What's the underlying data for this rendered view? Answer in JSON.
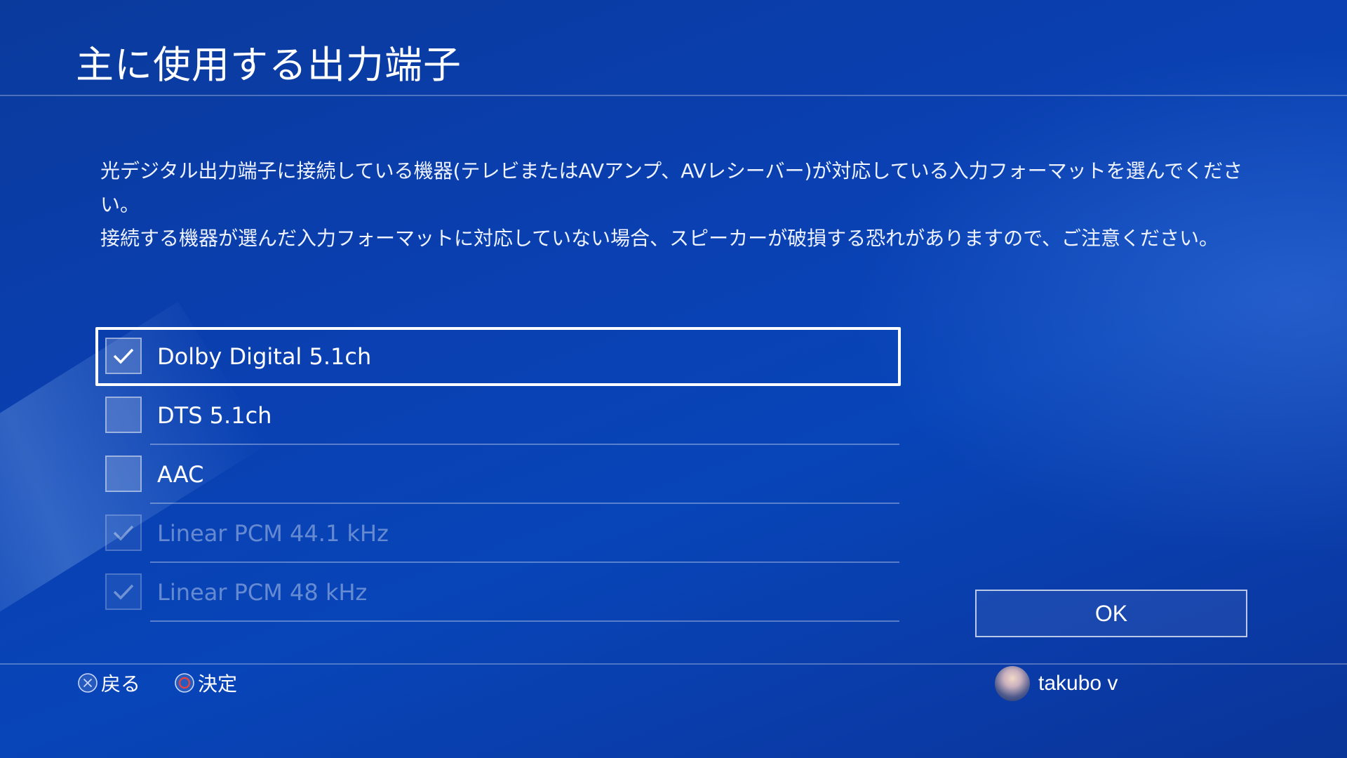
{
  "screen": {
    "title": "主に使用する出力端子",
    "description": [
      "光デジタル出力端子に接続している機器(テレビまたはAVアンプ、AVレシーバー)が対応している入力フォーマットを選んでください。",
      "接続する機器が選んだ入力フォーマットに対応していない場合、スピーカーが破損する恐れがありますので、ご注意ください。"
    ]
  },
  "options": [
    {
      "label": "Dolby Digital 5.1ch",
      "checked": true,
      "enabled": true,
      "focused": true
    },
    {
      "label": "DTS 5.1ch",
      "checked": false,
      "enabled": true,
      "focused": false
    },
    {
      "label": "AAC",
      "checked": false,
      "enabled": true,
      "focused": false
    },
    {
      "label": "Linear PCM 44.1 kHz",
      "checked": true,
      "enabled": false,
      "focused": false
    },
    {
      "label": "Linear PCM 48 kHz",
      "checked": true,
      "enabled": false,
      "focused": false
    }
  ],
  "ok_button": {
    "label": "OK"
  },
  "footer": {
    "back_label": "戻る",
    "confirm_label": "決定",
    "back_icon": "cross-button-icon",
    "confirm_icon": "circle-button-icon",
    "username": "takubo v"
  },
  "colors": {
    "background": "#0a3fb0",
    "confirm_icon": "#e8413e"
  }
}
